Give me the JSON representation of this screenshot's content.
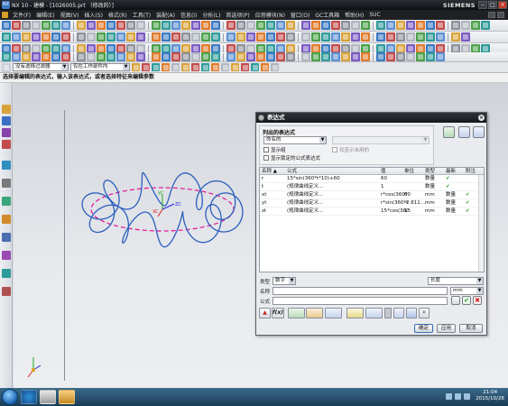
{
  "window": {
    "app_badge": "NX",
    "title": "NX 10 - 建模 - [1026005.prt （修改的）]",
    "brand": "SIEMENS",
    "controls": [
      "–",
      "□",
      "×"
    ]
  },
  "menu": {
    "items": [
      "文件(F)",
      "编辑(E)",
      "视图(V)",
      "插入(S)",
      "格式(R)",
      "工具(T)",
      "装配(A)",
      "信息(I)",
      "分析(L)",
      "首选项(P)",
      "应用模块(N)",
      "窗口(O)",
      "GC工具箱",
      "帮助(H)",
      "SUC"
    ]
  },
  "selection_bar": {
    "filter": "没有选择过滤器",
    "scope": "仅在工作部件内"
  },
  "cue_line": "选择要编辑的表达式，输入该表达式，或者选择特征来编辑参数",
  "taskbar": {
    "time": "21:04",
    "date": "2015/10/26"
  },
  "dialog": {
    "title": "表达式",
    "group_title": "列出的表达式",
    "list_filter": "命名的",
    "checkboxes": [
      {
        "label": "显示组",
        "checked": false,
        "enabled": true
      },
      {
        "label": "显示锁定的公式表达式",
        "checked": false,
        "enabled": true
      },
      {
        "label": "仅显示未用的",
        "checked": false,
        "enabled": false
      }
    ],
    "columns": [
      "名称",
      "公式",
      "值",
      "单位",
      "类型",
      "最新",
      "附注"
    ],
    "sort_indicator": "▲",
    "rows": [
      {
        "name": "r",
        "formula": "15*sin(360*t*10)+60",
        "value": "60",
        "unit": "",
        "type": "数量",
        "latest": "✔",
        "note": ""
      },
      {
        "name": "t",
        "formula": "(规律曲线定义...",
        "value": "1",
        "unit": "",
        "type": "数量",
        "latest": "✔",
        "note": ""
      },
      {
        "name": "xt",
        "formula": "(规律曲线定义...",
        "value": "r*cos(360*t)",
        "unit": "60",
        "type": "mm",
        "latest": "数量",
        "note": "✔"
      },
      {
        "name": "yt",
        "formula": "(规律曲线定义...",
        "value": "r*sin(360*t)",
        "unit": "-2.811...",
        "type": "mm",
        "latest": "数量",
        "note": "✔"
      },
      {
        "name": "zt",
        "formula": "(规律曲线定义...",
        "value": "15*cos(360*t*10)",
        "unit": "15",
        "type": "mm",
        "latest": "数量",
        "note": "✔"
      }
    ],
    "type_label": "类型",
    "type_value": "数字",
    "dimension_value": "长度",
    "name_label": "名称",
    "name_value": "",
    "unit_value": "mm",
    "formula_label": "公式",
    "formula_value": "",
    "fx_label": "f(x)",
    "buttons": {
      "ok": "确定",
      "apply": "应用",
      "cancel": "取消"
    }
  },
  "colors": {
    "curve": "#2c5fbd",
    "ellipse": "#e0239b",
    "axis_x": "#d22",
    "axis_y": "#2a2",
    "axis_z": "#22d"
  }
}
